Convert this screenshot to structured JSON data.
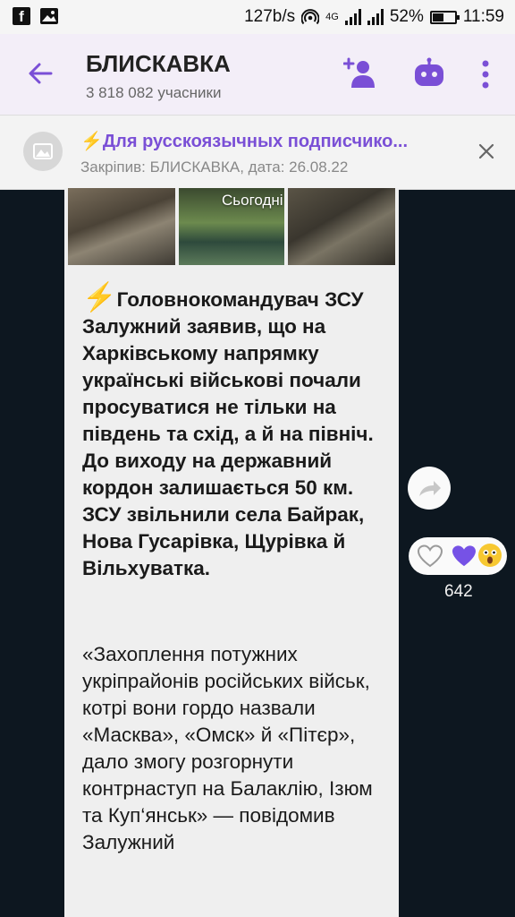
{
  "status_bar": {
    "speed": "127b/s",
    "network": "4G",
    "battery": "52%",
    "battery_level": 0.52,
    "time": "11:59"
  },
  "header": {
    "title": "БЛИСКАВКА",
    "subtitle": "3 818 082 учасники"
  },
  "pinned": {
    "title": "⚡Для русскоязычных подписчико...",
    "subtitle": "Закріпив: БЛИСКАВКА, дата: 26.08.22"
  },
  "date_divider": "Сьогодні",
  "message": {
    "text_bold": "Головнокомандувач ЗСУ Залужний заявив, що на Харківському напрямку українські військові почали просуватися не тільки на південь та схід, а й на північ. До виходу на державний кордон залишається 50 км. ЗСУ звільнили села Байрак, Нова Гусарівка, Щурівка й Вільхуватка.",
    "bolt": "⚡",
    "text_quote": "«Захоплення потужних укріпрайонів російських військ, котрі вони гордо назвали «Масква», «Омск» й «Пітєр», дало змогу розгорнути контрнаступ на Балаклію, Ізюм та Куп‘янськ» — повідомив Залужний"
  },
  "reactions": {
    "count": "642",
    "icons": [
      "heart-outline",
      "purple-heart",
      "scared-face"
    ]
  },
  "colors": {
    "accent": "#7a4fd6",
    "chat_bg": "#0d1720",
    "bubble_bg": "#efefef",
    "header_bg": "#f3eef8",
    "bolt": "#f2c230"
  }
}
